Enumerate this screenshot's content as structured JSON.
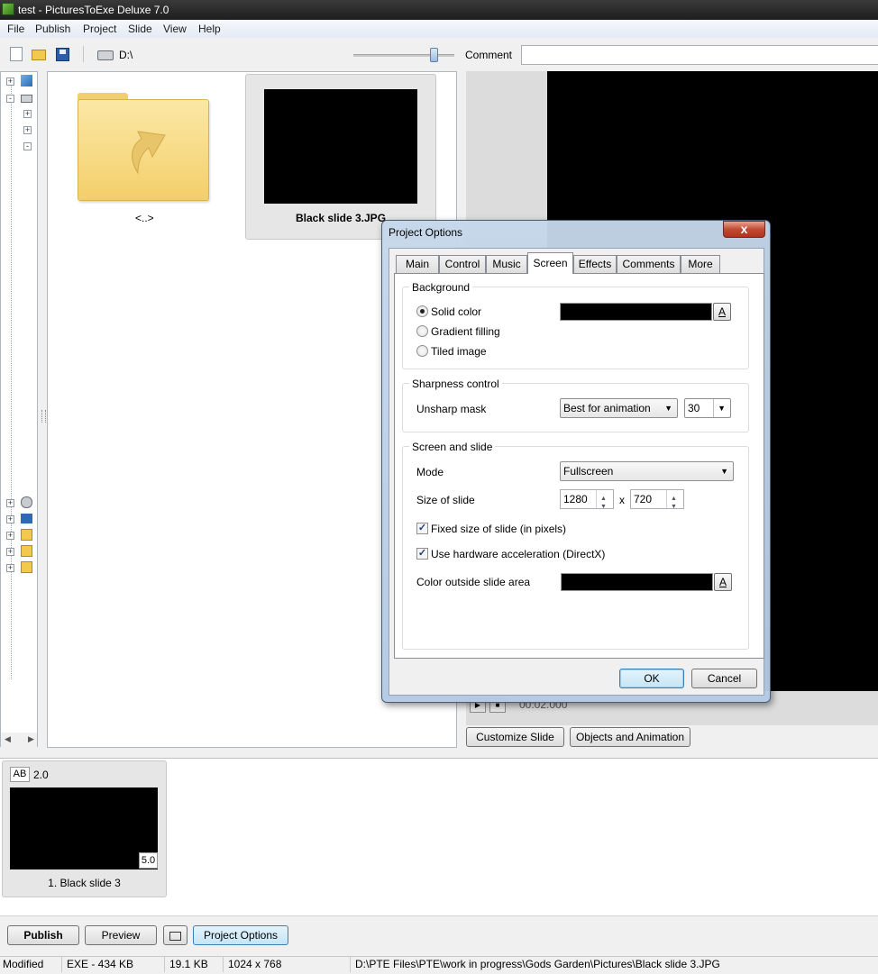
{
  "window": {
    "title": "test - PicturesToExe Deluxe 7.0"
  },
  "menu": [
    "File",
    "Publish",
    "Project",
    "Slide",
    "View",
    "Help"
  ],
  "toolbar": {
    "drive": "D:\\",
    "comment_label": "Comment",
    "comment_value": ""
  },
  "browser": {
    "items": [
      {
        "label": "<..>"
      },
      {
        "label": "Black slide 3.JPG"
      }
    ]
  },
  "preview": {
    "time": "00:02.000"
  },
  "preview_buttons": {
    "customize": "Customize Slide",
    "objects": "Objects and Animation"
  },
  "slides": [
    {
      "badge": "AB",
      "transition": "2.0",
      "duration": "5.0",
      "label": "1. Black slide 3"
    }
  ],
  "bottom": {
    "publish": "Publish",
    "preview": "Preview",
    "project_options": "Project Options"
  },
  "status": {
    "state": "Modified",
    "exe": "EXE - 434 KB",
    "size": "19.1 KB",
    "dims": "1024 x 768",
    "path": "D:\\PTE Files\\PTE\\work in progress\\Gods Garden\\Pictures\\Black slide 3.JPG"
  },
  "dialog": {
    "title": "Project Options",
    "close": "x",
    "tabs": [
      "Main",
      "Control",
      "Music",
      "Screen",
      "Effects",
      "Comments",
      "More"
    ],
    "active_tab": "Screen",
    "background": {
      "legend": "Background",
      "options": [
        "Solid color",
        "Gradient filling",
        "Tiled image"
      ],
      "selected": "Solid color",
      "color": "#000000",
      "color_button": "A"
    },
    "sharpness": {
      "legend": "Sharpness control",
      "label": "Unsharp mask",
      "mode": "Best for animation",
      "amount": "30"
    },
    "screen": {
      "legend": "Screen and slide",
      "mode_label": "Mode",
      "mode": "Fullscreen",
      "size_label": "Size of slide",
      "width": "1280",
      "separator": "x",
      "height": "720",
      "fixed_size": "Fixed size of slide (in pixels)",
      "fixed_size_checked": true,
      "hw_accel": "Use hardware acceleration (DirectX)",
      "hw_accel_checked": true,
      "outside_color_label": "Color outside slide area",
      "outside_color": "#000000",
      "color_button": "A"
    },
    "ok": "OK",
    "cancel": "Cancel"
  }
}
